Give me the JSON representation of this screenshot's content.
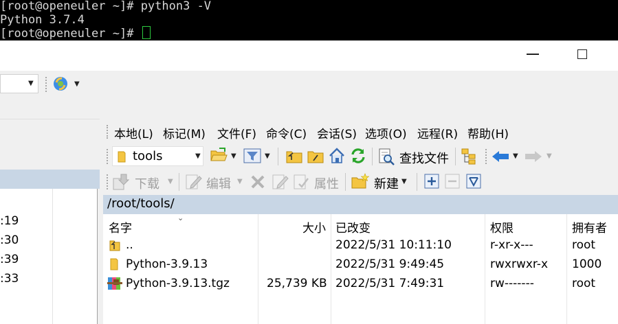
{
  "terminal": {
    "lines": [
      "[root@openeuler ~]# python3 -V",
      "Python 3.7.4",
      "[root@openeuler ~]# "
    ]
  },
  "left_pane": {
    "times": [
      ":19",
      ":30",
      ":39",
      ":33"
    ]
  },
  "menu": {
    "items": [
      "本地(L)",
      "标记(M)",
      "文件(F)",
      "命令(C)",
      "会话(S)",
      "选项(O)",
      "远程(R)",
      "帮助(H)"
    ]
  },
  "toolbar": {
    "path_combo": "tools",
    "find_files": "查找文件",
    "download": "下载",
    "edit": "编辑",
    "properties": "属性",
    "new": "新建"
  },
  "remote": {
    "path": "/root/tools/",
    "columns": [
      "名字",
      "大小",
      "已改变",
      "权限",
      "拥有者"
    ],
    "rows": [
      {
        "name": "..",
        "size": "",
        "changed": "2022/5/31 10:11:10",
        "rights": "r-xr-x---",
        "owner": "root"
      },
      {
        "name": "Python-3.9.13",
        "size": "",
        "changed": "2022/5/31 9:49:45",
        "rights": "rwxrwxr-x",
        "owner": "1000"
      },
      {
        "name": "Python-3.9.13.tgz",
        "size": "25,739 KB",
        "changed": "2022/5/31 7:49:31",
        "rights": "rw-------",
        "owner": "root"
      }
    ]
  },
  "colors": {
    "path_bar": "#c8d6e5",
    "terminal_bg": "#000000",
    "cursor": "#2ecc40",
    "folder": "#f4c542",
    "refresh": "#2aa52a",
    "back_arrow": "#2a7ad8"
  }
}
